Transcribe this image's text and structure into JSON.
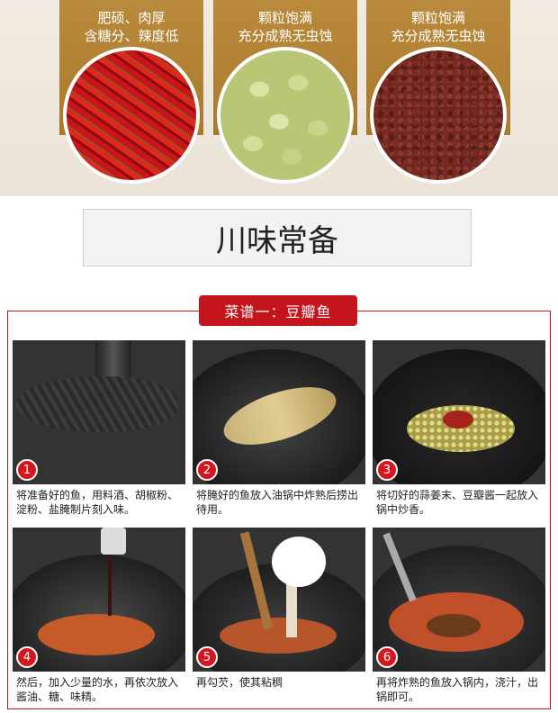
{
  "ingredients": [
    {
      "caption_line1": "肥硕、肉厚",
      "caption_line2": "含糖分、辣度低",
      "image": "red-chili-image"
    },
    {
      "caption_line1": "颗粒饱满",
      "caption_line2": "充分成熟无虫蚀",
      "image": "broad-bean-image"
    },
    {
      "caption_line1": "颗粒饱满",
      "caption_line2": "充分成熟无虫蚀",
      "image": "sichuan-pepper-image"
    }
  ],
  "section_title": "川味常备",
  "recipe_label": "菜谱一：豆瓣鱼",
  "steps": [
    {
      "number": "1",
      "text": "将准备好的鱼，用料酒、胡椒粉、淀粉、盐腌制片刻入味。"
    },
    {
      "number": "2",
      "text": "将腌好的鱼放入油锅中炸熟后捞出待用。"
    },
    {
      "number": "3",
      "text": "将切好的蒜姜末、豆瓣酱一起放入锅中炒香。"
    },
    {
      "number": "4",
      "text": "然后，加入少量的水，再依次放入酱油、糖、味精。"
    },
    {
      "number": "5",
      "text": "再勾芡，使其粘稠"
    },
    {
      "number": "6",
      "text": "再将炸熟的鱼放入锅内，浇汁，出锅即可。"
    }
  ],
  "colors": {
    "accent": "#c4141c",
    "gold": "#b08235",
    "background": "#ebe3d8"
  }
}
